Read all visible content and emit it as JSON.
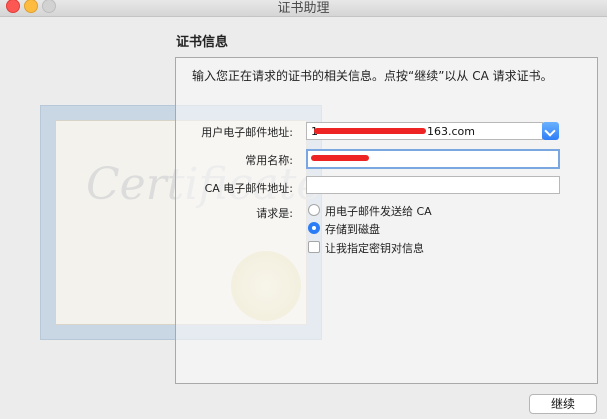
{
  "window": {
    "title": "证书助理"
  },
  "section_title": "证书信息",
  "instruction": "输入您正在请求的证书的相关信息。点按“继续”以从 CA 请求证书。",
  "background_art": {
    "text": "Certificate"
  },
  "form": {
    "email_label": "用户电子邮件地址:",
    "email_value_prefix": "1",
    "email_value_suffix": "163.com",
    "name_label": "常用名称:",
    "name_value": "",
    "ca_email_label": "CA 电子邮件地址:",
    "ca_email_value": "",
    "request_label": "请求是:",
    "options": {
      "send_to_ca": "用电子邮件发送给 CA",
      "save_to_disk": "存储到磁盘",
      "specify_key": "让我指定密钥对信息"
    },
    "selected_option": "save_to_disk",
    "specify_key_checked": false
  },
  "buttons": {
    "continue": "继续"
  },
  "colors": {
    "accent": "#2c7df5",
    "redaction": "#ee2323"
  }
}
